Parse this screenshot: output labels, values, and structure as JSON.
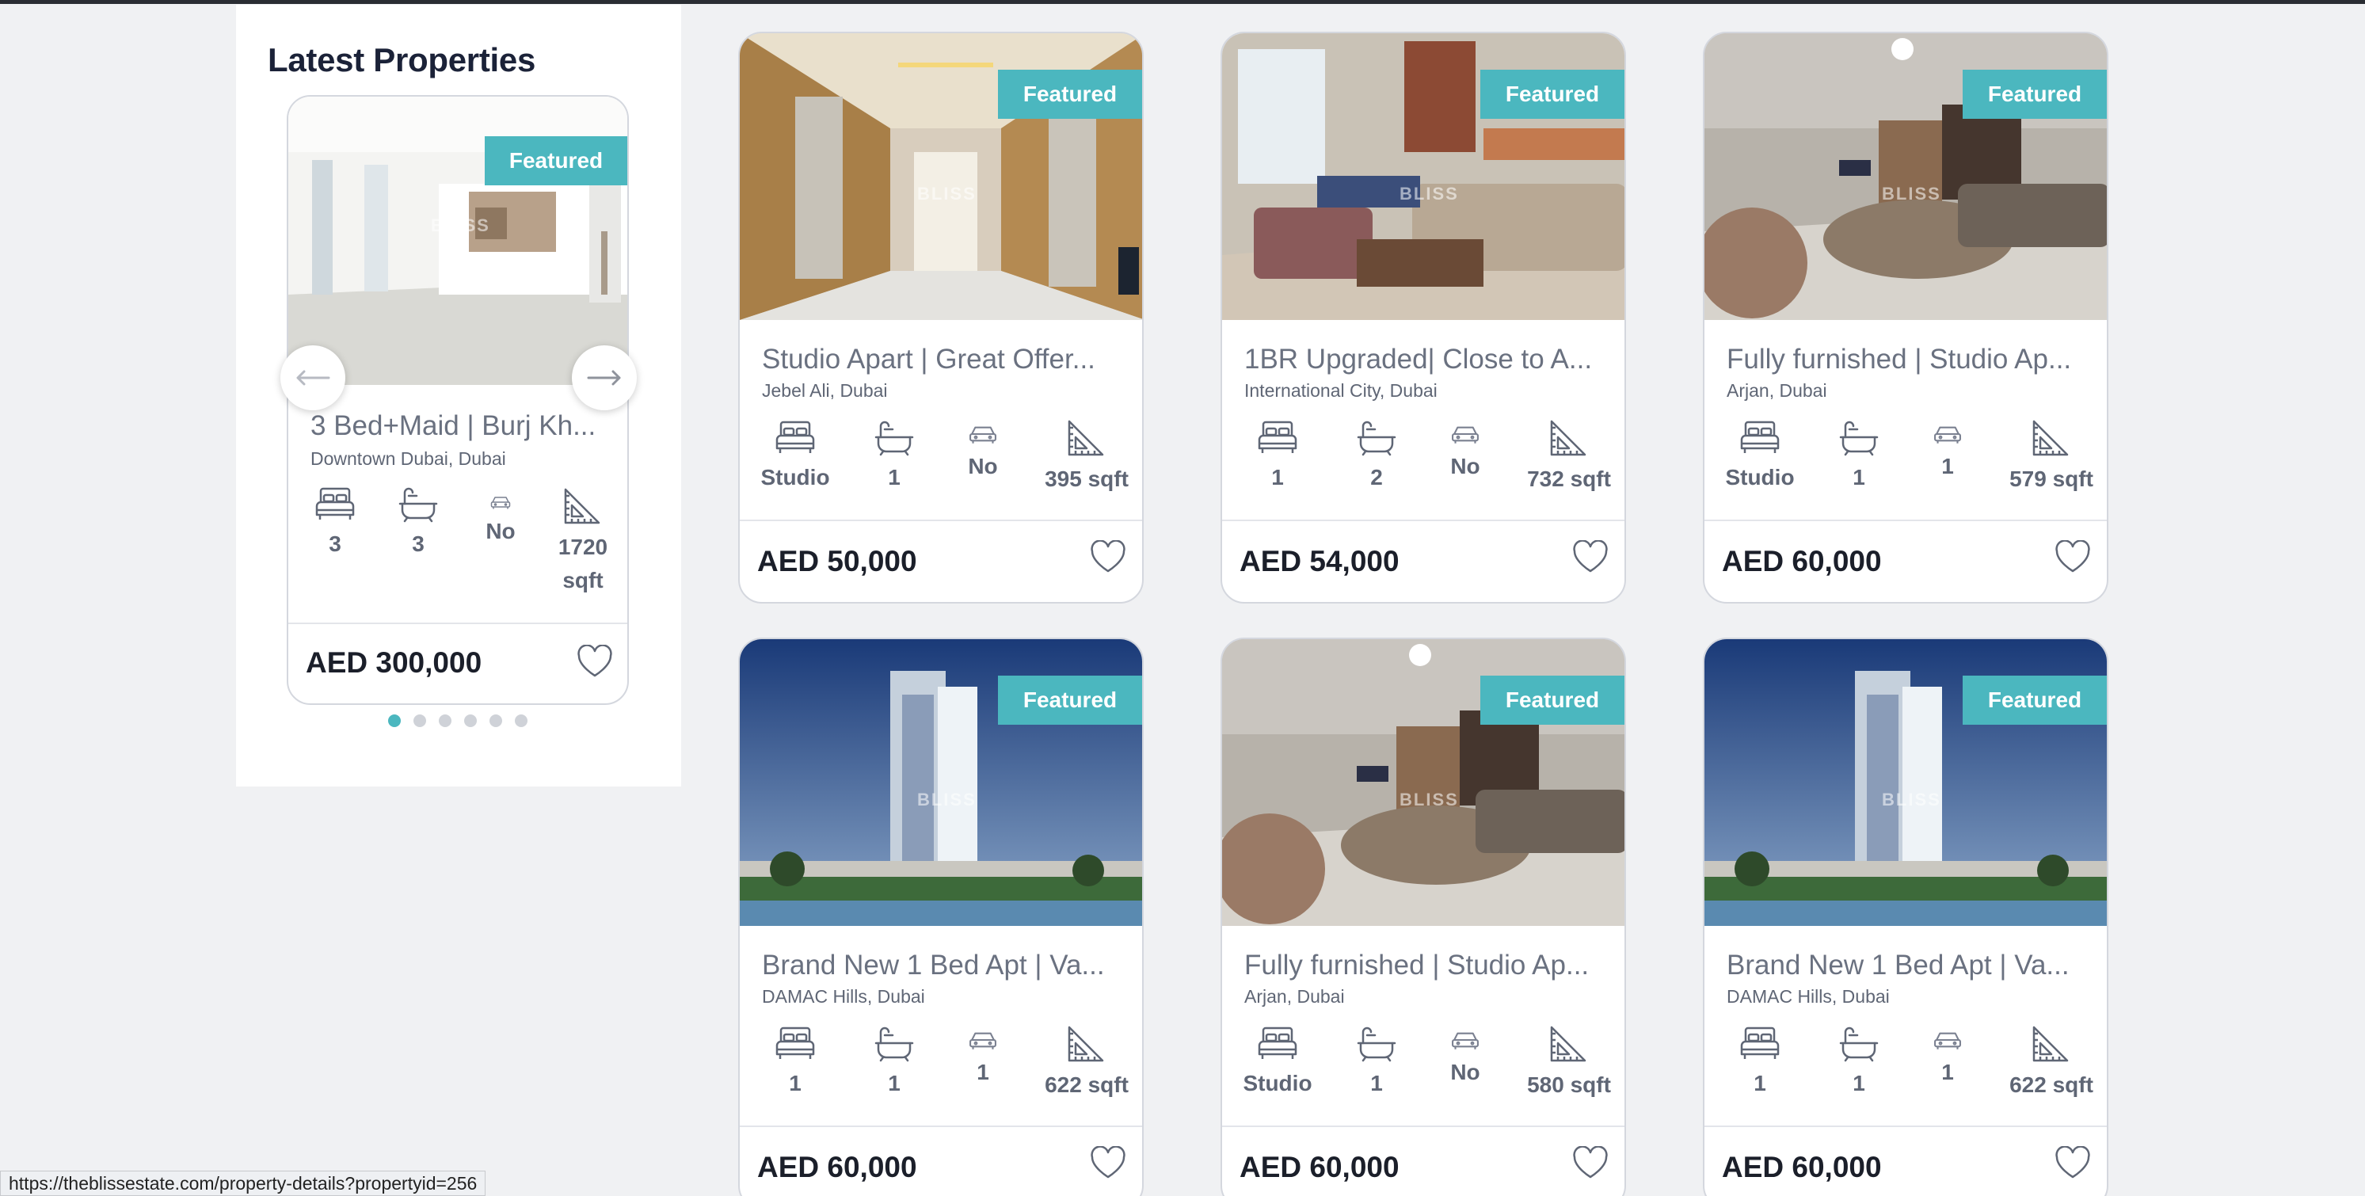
{
  "sidebar": {
    "title": "Latest Properties",
    "card": {
      "badge": "Featured",
      "title": "3 Bed+Maid | Burj Kh...",
      "location": "Downtown Dubai, Dubai",
      "beds": "3",
      "baths": "3",
      "parking": "No",
      "area": "1720 sqft",
      "price": "AED 300,000"
    },
    "dots_total": 6,
    "dots_active_index": 0
  },
  "listings": [
    {
      "badge": "Featured",
      "title": "Studio Apart | Great Offer...",
      "location": "Jebel Ali, Dubai",
      "beds": "Studio",
      "baths": "1",
      "parking": "No",
      "area": "395 sqft",
      "price": "AED 50,000"
    },
    {
      "badge": "Featured",
      "title": "1BR Upgraded| Close to A...",
      "location": "International City, Dubai",
      "beds": "1",
      "baths": "2",
      "parking": "No",
      "area": "732 sqft",
      "price": "AED 54,000"
    },
    {
      "badge": "Featured",
      "title": "Fully furnished | Studio Ap...",
      "location": "Arjan, Dubai",
      "beds": "Studio",
      "baths": "1",
      "parking": "1",
      "area": "579 sqft",
      "price": "AED 60,000"
    },
    {
      "badge": "Featured",
      "title": "Brand New 1 Bed Apt | Va...",
      "location": "DAMAC Hills, Dubai",
      "beds": "1",
      "baths": "1",
      "parking": "1",
      "area": "622 sqft",
      "price": "AED 60,000"
    },
    {
      "badge": "Featured",
      "title": "Fully furnished | Studio Ap...",
      "location": "Arjan, Dubai",
      "beds": "Studio",
      "baths": "1",
      "parking": "No",
      "area": "580 sqft",
      "price": "AED 60,000"
    },
    {
      "badge": "Featured",
      "title": "Brand New 1 Bed Apt | Va...",
      "location": "DAMAC Hills, Dubai",
      "beds": "1",
      "baths": "1",
      "parking": "1",
      "area": "622 sqft",
      "price": "AED 60,000"
    }
  ],
  "status_url": "https://theblissestate.com/property-details?propertyid=256",
  "watermark": "BLISS",
  "colors": {
    "accent": "#4bb7bf",
    "page_bg": "#f0f1f3",
    "card_border": "#d4d7de"
  }
}
